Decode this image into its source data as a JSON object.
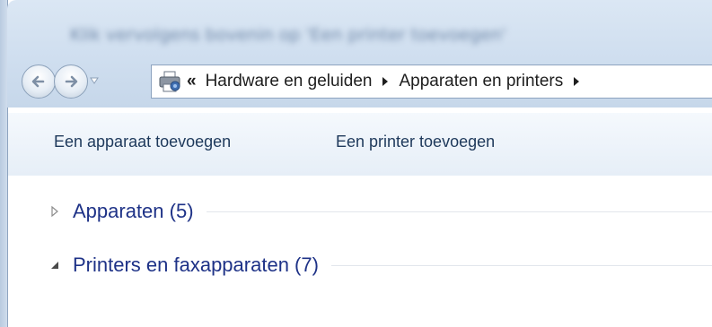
{
  "window": {
    "title": "Klik vervolgens bovenin op 'Een printer toevoegen'"
  },
  "navigation": {
    "back_icon": "back-arrow-icon",
    "forward_icon": "forward-arrow-icon",
    "recent_icon": "dropdown-arrow-icon"
  },
  "address": {
    "icon": "devices-printers-icon",
    "overflow": "«",
    "crumbs": [
      "Hardware en geluiden",
      "Apparaten en printers"
    ]
  },
  "toolbar": {
    "add_device_label": "Een apparaat toevoegen",
    "add_printer_label": "Een printer toevoegen"
  },
  "groups": [
    {
      "label": "Apparaten (5)",
      "expanded": false
    },
    {
      "label": "Printers en faxapparaten (7)",
      "expanded": true
    }
  ],
  "colors": {
    "group_text": "#1e3287",
    "toolbar_text": "#1e395b",
    "chrome": "#cfdeef"
  }
}
